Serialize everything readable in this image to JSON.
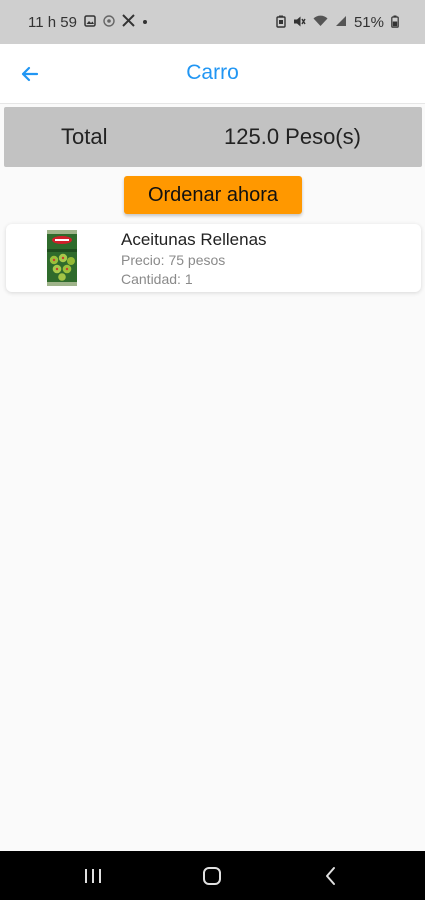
{
  "status_bar": {
    "time": "11 h 59",
    "battery": "51%",
    "icons": [
      "gallery-icon",
      "notification-icon",
      "x-app-icon",
      "dot-icon",
      "battery-saver-icon",
      "mute-icon",
      "wifi-icon",
      "signal-icon",
      "battery-icon"
    ]
  },
  "app_bar": {
    "title": "Carro",
    "back_icon": "arrow-back-icon",
    "accent_color": "#2196f3"
  },
  "total": {
    "label": "Total",
    "value": "125.0 Peso(s)"
  },
  "order_button": {
    "label": "Ordenar ahora",
    "color": "#ff9800"
  },
  "cart": {
    "items": [
      {
        "name": "Aceitunas Rellenas",
        "price": "Precio: 75 pesos",
        "quantity": "Cantidad: 1",
        "image_icon": "olive-can-icon"
      }
    ]
  },
  "nav_bar": {
    "icons": [
      "recent-apps-icon",
      "home-icon",
      "back-icon"
    ]
  }
}
